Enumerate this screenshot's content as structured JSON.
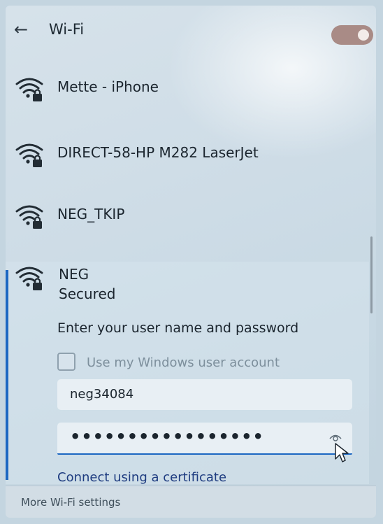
{
  "header": {
    "back_icon": "back-arrow-icon",
    "title": "Wi-Fi",
    "toggle_state": "on"
  },
  "networks": [
    {
      "name": "Mette - iPhone",
      "icon": "wifi-locked-icon"
    },
    {
      "name": "DIRECT-58-HP M282 LaserJet",
      "icon": "wifi-locked-icon"
    },
    {
      "name": "NEG_TKIP",
      "icon": "wifi-locked-icon"
    },
    {
      "name": "NEG",
      "icon": "wifi-locked-icon",
      "status": "Secured"
    }
  ],
  "connect_form": {
    "prompt": "Enter your user name and password",
    "use_windows_account_label": "Use my Windows user account",
    "use_windows_account_checked": false,
    "username_value": "neg34084",
    "password_masked": "•••••••••••••••••",
    "reveal_icon": "eye-icon",
    "certificate_link": "Connect using a certificate"
  },
  "footer": {
    "more_settings": "More Wi-Fi settings"
  },
  "colors": {
    "accent": "#1c67c2",
    "toggle_on": "#a98b86"
  }
}
